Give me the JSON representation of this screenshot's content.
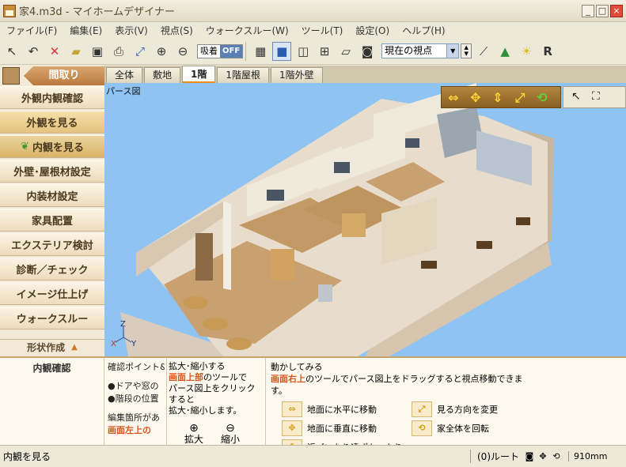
{
  "window": {
    "title": "家4.m3d - マイホームデザイナー"
  },
  "menu": [
    "ファイル(F)",
    "編集(E)",
    "表示(V)",
    "視点(S)",
    "ウォークスルー(W)",
    "ツール(T)",
    "設定(O)",
    "ヘルプ(H)"
  ],
  "toolbar": {
    "snap_label": "吸着",
    "snap_state": "OFF",
    "viewpoint_value": "現在の視点"
  },
  "left_panel": {
    "madori_tab": "間取り",
    "buttons": [
      {
        "id": "gaikan-naikan",
        "label": "外観内観確認"
      },
      {
        "id": "gaikan",
        "label": "外観を見る"
      },
      {
        "id": "naikan",
        "label": "内観を見る"
      },
      {
        "id": "gaiheki",
        "label": "外壁･屋根材設定"
      },
      {
        "id": "naisou",
        "label": "内装材設定"
      },
      {
        "id": "kagu",
        "label": "家具配置"
      },
      {
        "id": "exterior",
        "label": "エクステリア検討"
      },
      {
        "id": "shindan",
        "label": "診断／チェック"
      },
      {
        "id": "image",
        "label": "イメージ仕上げ"
      },
      {
        "id": "walkthrough",
        "label": "ウォークスルー"
      }
    ],
    "shape_create": "形状作成"
  },
  "floor_tabs": [
    "全体",
    "敷地",
    "1階",
    "1階屋根",
    "1階外壁"
  ],
  "active_floor_tab": "1階",
  "view": {
    "label": "パース図",
    "axis": {
      "z": "Z",
      "x": "X",
      "y": "Y"
    }
  },
  "help": {
    "section_title": "内観確認",
    "confirm_title": "確認ポイント&",
    "confirm_lines": [
      "●ドアや窓の",
      "●階段の位置",
      "編集箇所があ",
      "画面左上の"
    ],
    "zoom_title": "拡大･縮小する",
    "zoom_emph": "画面上部",
    "zoom_text1": "のツールで",
    "zoom_text2": "パース図上をクリックすると",
    "zoom_text3": "拡大･縮小します。",
    "zoom_in": "拡大",
    "zoom_out": "縮小",
    "move_title": "動かしてみる",
    "move_emph": "画面右上",
    "move_text": "のツールでパース図上をドラッグすると視点移動できます。",
    "move_items": [
      "地面に水平に移動",
      "地面に垂直に移動",
      "近づいたり遠ざかったり",
      "見る方向を変更",
      "家全体を回転"
    ]
  },
  "status": {
    "left": "内観を見る",
    "route": "(0)ルート",
    "grid": "910mm"
  }
}
